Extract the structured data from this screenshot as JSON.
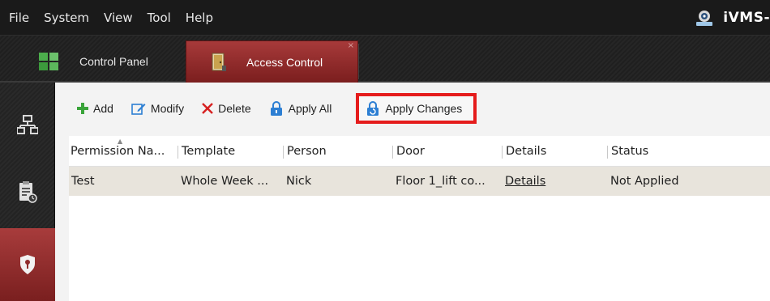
{
  "menu": [
    "File",
    "System",
    "View",
    "Tool",
    "Help"
  ],
  "brand": {
    "text": "iVMS-"
  },
  "tabs": [
    {
      "label": "Control Panel",
      "active": false
    },
    {
      "label": "Access Control",
      "active": true
    }
  ],
  "tab_close_glyph": "×",
  "toolbar": {
    "add": "Add",
    "modify": "Modify",
    "delete": "Delete",
    "apply_all": "Apply All",
    "apply_changes": "Apply Changes"
  },
  "table": {
    "columns": [
      "Permission Na...",
      "Template",
      "Person",
      "Door",
      "Details",
      "Status"
    ],
    "rows": [
      {
        "permission": "Test",
        "template": "Whole Week ...",
        "person": "Nick",
        "door": "Floor 1_lift co...",
        "details": "Details",
        "status": "Not Applied"
      }
    ]
  },
  "colors": {
    "accent_red": "#8f2b2b",
    "highlight_border": "#e51c1c",
    "add_green": "#3aa43a",
    "delete_red": "#d62020",
    "icon_blue": "#2d7fd3"
  },
  "icons": {
    "brand": "camera-icon",
    "control_panel": "grid-icon",
    "access_control": "door-icon",
    "rail": [
      "network-icon",
      "report-icon",
      "shield-icon"
    ]
  }
}
